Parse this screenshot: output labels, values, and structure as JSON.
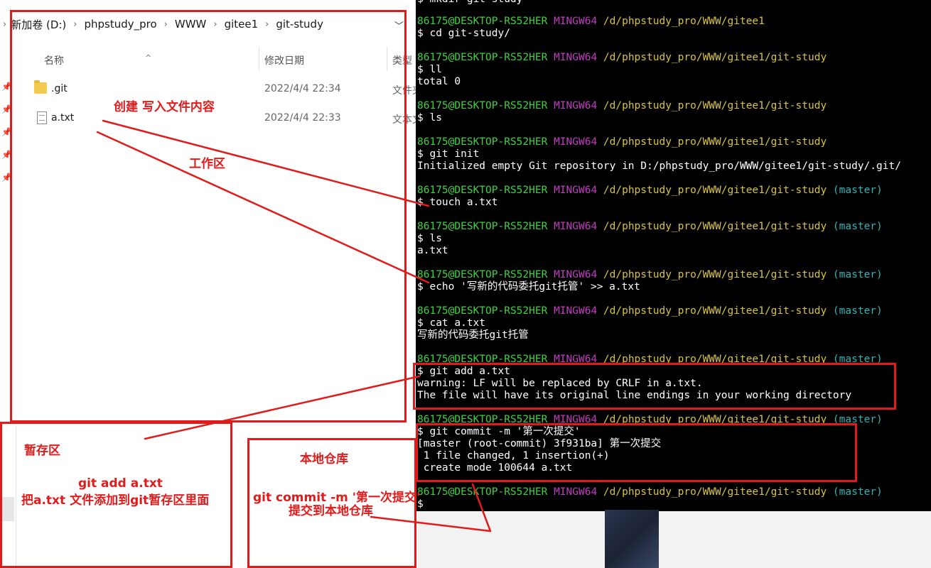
{
  "explorer": {
    "breadcrumb": [
      "新加卷 (D:)",
      "phpstudy_pro",
      "WWW",
      "gitee1",
      "git-study"
    ],
    "columns": {
      "name": "名称",
      "modified": "修改日期",
      "type": "类型"
    },
    "files": [
      {
        "name": ".git",
        "modified": "2022/4/4 22:34",
        "type": "文件夹"
      },
      {
        "name": "a.txt",
        "modified": "2022/4/4 22:33",
        "type": "文本文档"
      }
    ]
  },
  "terminal": {
    "top_partial": "$ mkdir git-study",
    "prompt": {
      "user": "86175@DESKTOP-RS52HER",
      "env": "MINGW64"
    },
    "blocks": [
      {
        "path": "/d/phpstudy_pro/WWW/gitee1",
        "branch": "",
        "lines": [
          "$ cd git-study/"
        ]
      },
      {
        "path": "/d/phpstudy_pro/WWW/gitee1/git-study",
        "branch": "",
        "lines": [
          "$ ll",
          "total 0"
        ]
      },
      {
        "path": "/d/phpstudy_pro/WWW/gitee1/git-study",
        "branch": "",
        "lines": [
          "$ ls"
        ]
      },
      {
        "path": "/d/phpstudy_pro/WWW/gitee1/git-study",
        "branch": "",
        "lines": [
          "$ git init",
          "Initialized empty Git repository in D:/phpstudy_pro/WWW/gitee1/git-study/.git/"
        ]
      },
      {
        "path": "/d/phpstudy_pro/WWW/gitee1/git-study",
        "branch": "(master)",
        "lines": [
          "$ touch a.txt"
        ]
      },
      {
        "path": "/d/phpstudy_pro/WWW/gitee1/git-study",
        "branch": "(master)",
        "lines": [
          "$ ls",
          "a.txt"
        ]
      },
      {
        "path": "/d/phpstudy_pro/WWW/gitee1/git-study",
        "branch": "(master)",
        "lines": [
          "$ echo '写新的代码委托git托管' >> a.txt"
        ]
      },
      {
        "path": "/d/phpstudy_pro/WWW/gitee1/git-study",
        "branch": "(master)",
        "lines": [
          "$ cat a.txt",
          "写新的代码委托git托管"
        ]
      },
      {
        "path": "/d/phpstudy_pro/WWW/gitee1/git-study",
        "branch": "(master)",
        "lines": [
          "$ git add a.txt",
          "warning: LF will be replaced by CRLF in a.txt.",
          "The file will have its original line endings in your working directory"
        ]
      },
      {
        "path": "/d/phpstudy_pro/WWW/gitee1/git-study",
        "branch": "(master)",
        "lines": [
          "$ git commit -m '第一次提交'",
          "[master (root-commit) 3f931ba] 第一次提交",
          " 1 file changed, 1 insertion(+)",
          " create mode 100644 a.txt"
        ]
      },
      {
        "path": "/d/phpstudy_pro/WWW/gitee1/git-study",
        "branch": "(master)",
        "lines": [
          "$"
        ]
      }
    ]
  },
  "annotations": {
    "create_write": "创建 写入文件内容",
    "workspace": "工作区",
    "staging": "暂存区",
    "staging_cmd": "git  add  a.txt",
    "staging_desc": "把a.txt 文件添加到git暂存区里面",
    "local_repo": "本地仓库",
    "commit_cmd": "git  commit  -m  '第一次提交'",
    "commit_desc": "提交到本地仓库"
  },
  "colors": {
    "annotation": "#e01b1b",
    "prompt_user": "#3fd23f",
    "prompt_env": "#c13cc1",
    "prompt_path": "#d7c342",
    "prompt_branch": "#2fb5b5",
    "terminal_bg": "#000000"
  },
  "icons": [
    "folder-icon",
    "text-file-icon",
    "pin-icon",
    "chevron-down-icon",
    "chevron-right-icon"
  ]
}
